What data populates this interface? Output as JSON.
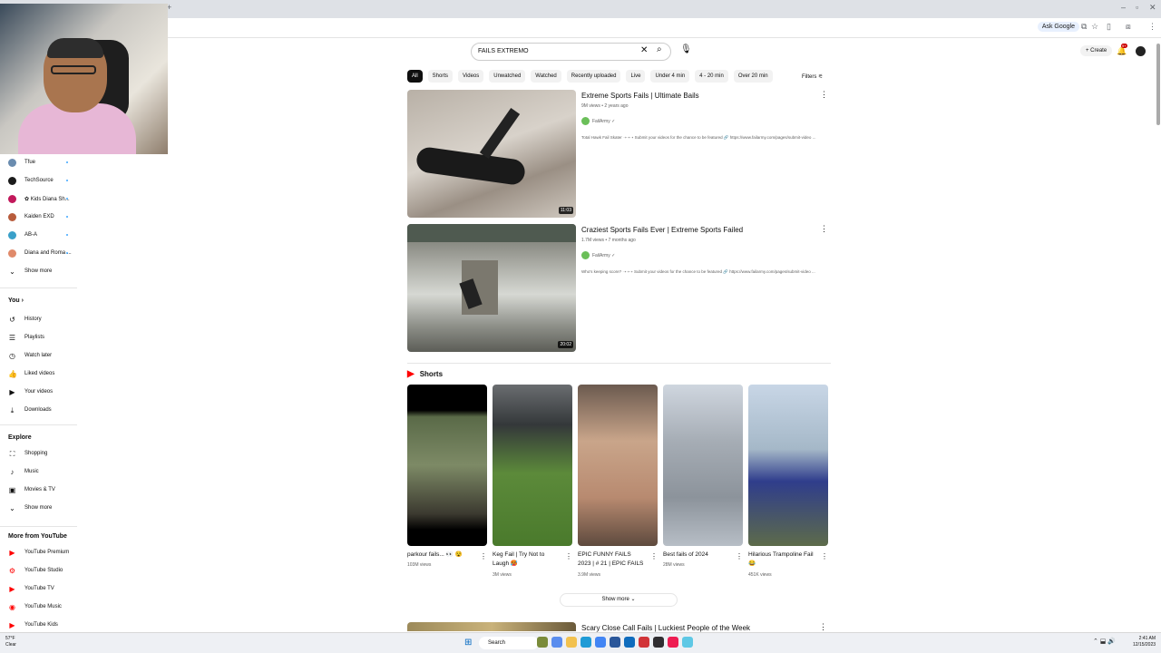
{
  "browser": {
    "ask_google": "Ask Google",
    "min": "–",
    "max": "▫",
    "close": "✕",
    "tab_plus": "+"
  },
  "sidebar": {
    "subscriptions": [
      {
        "label": "Tfue",
        "color": "#6a8caf"
      },
      {
        "label": "TechSource",
        "color": "#1b1b1b"
      },
      {
        "label": "✿ Kids Diana Sh...",
        "color": "#c2185b"
      },
      {
        "label": "Kaiden EXD",
        "color": "#b85c3c"
      },
      {
        "label": "AB-A",
        "color": "#3aa0c9"
      },
      {
        "label": "Diana and Roma ...",
        "color": "#e08a6a"
      }
    ],
    "subs_show_more": "Show more",
    "you_title": "You",
    "you_items": [
      {
        "label": "History",
        "icon": "history-icon",
        "glyph": "↺"
      },
      {
        "label": "Playlists",
        "icon": "playlist-icon",
        "glyph": "☰"
      },
      {
        "label": "Watch later",
        "icon": "clock-icon",
        "glyph": "◷"
      },
      {
        "label": "Liked videos",
        "icon": "thumb-up-icon",
        "glyph": "👍"
      },
      {
        "label": "Your videos",
        "icon": "play-square-icon",
        "glyph": "▶"
      },
      {
        "label": "Downloads",
        "icon": "download-icon",
        "glyph": "⤓"
      }
    ],
    "explore_title": "Explore",
    "explore_items": [
      {
        "label": "Shopping",
        "icon": "bag-icon",
        "glyph": "⛶"
      },
      {
        "label": "Music",
        "icon": "music-icon",
        "glyph": "♪"
      },
      {
        "label": "Movies & TV",
        "icon": "film-icon",
        "glyph": "▣"
      },
      {
        "label": "Show more",
        "icon": "chevron-down-icon",
        "glyph": "⌄"
      }
    ],
    "more_title": "More from YouTube",
    "more_items": [
      {
        "label": "YouTube Premium",
        "icon": "yt-premium-icon",
        "glyph": "▶"
      },
      {
        "label": "YouTube Studio",
        "icon": "yt-studio-icon",
        "glyph": "⚙"
      },
      {
        "label": "YouTube TV",
        "icon": "yt-tv-icon",
        "glyph": "▶"
      },
      {
        "label": "YouTube Music",
        "icon": "yt-music-icon",
        "glyph": "◉"
      },
      {
        "label": "YouTube Kids",
        "icon": "yt-kids-icon",
        "glyph": "▶"
      }
    ]
  },
  "search": {
    "query": "FAILS EXTREMO",
    "clear": "✕",
    "search": "⌕",
    "mic": "🎙"
  },
  "header": {
    "create_label": "+ Create",
    "notifications": "9+"
  },
  "filters": {
    "chips": [
      "All",
      "Shorts",
      "Videos",
      "Unwatched",
      "Watched",
      "Recently uploaded",
      "Live",
      "Under 4 min",
      "4 - 20 min",
      "Over 20 min"
    ],
    "filters_label": "Filters ⚟"
  },
  "videos": [
    {
      "title": "Extreme Sports Fails | Ultimate Bails",
      "meta": "9M views • 2 years ago",
      "channel": "FailArmy",
      "verified": "✓",
      "desc": "Total Hawk Fail Skater ➝➝➝ Submit your videos for the chance to be featured 🔗 https://www.failarmy.com/pages/submit-video ...",
      "duration": "11:03",
      "more": "⋮"
    },
    {
      "title": "Craziest Sports Fails Ever | Extreme Sports Failed",
      "meta": "1.7M views • 7 months ago",
      "channel": "FailArmy",
      "verified": "✓",
      "desc": "Who's keeping score? ➝➝➝ Submit your videos for the chance to be featured 🔗 https://www.failarmy.com/pages/submit-video ...",
      "duration": "20:02",
      "more": "⋮"
    }
  ],
  "shorts": {
    "title": "Shorts",
    "items": [
      {
        "title": "parkour fails... 👀 😵",
        "views": "103M views"
      },
      {
        "title": "Keg Fail | Try Not to Laugh 🥵",
        "views": "3M views"
      },
      {
        "title": "EPIC FUNNY FAILS 2023 | # 21 | EPIC FAILS ...",
        "views": "3.9M views"
      },
      {
        "title": "Best fails of 2024",
        "views": "28M views"
      },
      {
        "title": "Hilarious Trampoline Fail 😂",
        "views": "451K views"
      }
    ],
    "more": "⋮",
    "show_more": "Show more ⌄"
  },
  "next_video": {
    "title": "Scary Close Call Fails | Luckiest People of the Week",
    "more": "⋮"
  },
  "taskbar": {
    "temp": "57°F",
    "condition": "Clear",
    "search": "Search",
    "time": "2:41 AM",
    "date": "12/15/2023",
    "tray": "⌃ ⬓ 🔊"
  }
}
